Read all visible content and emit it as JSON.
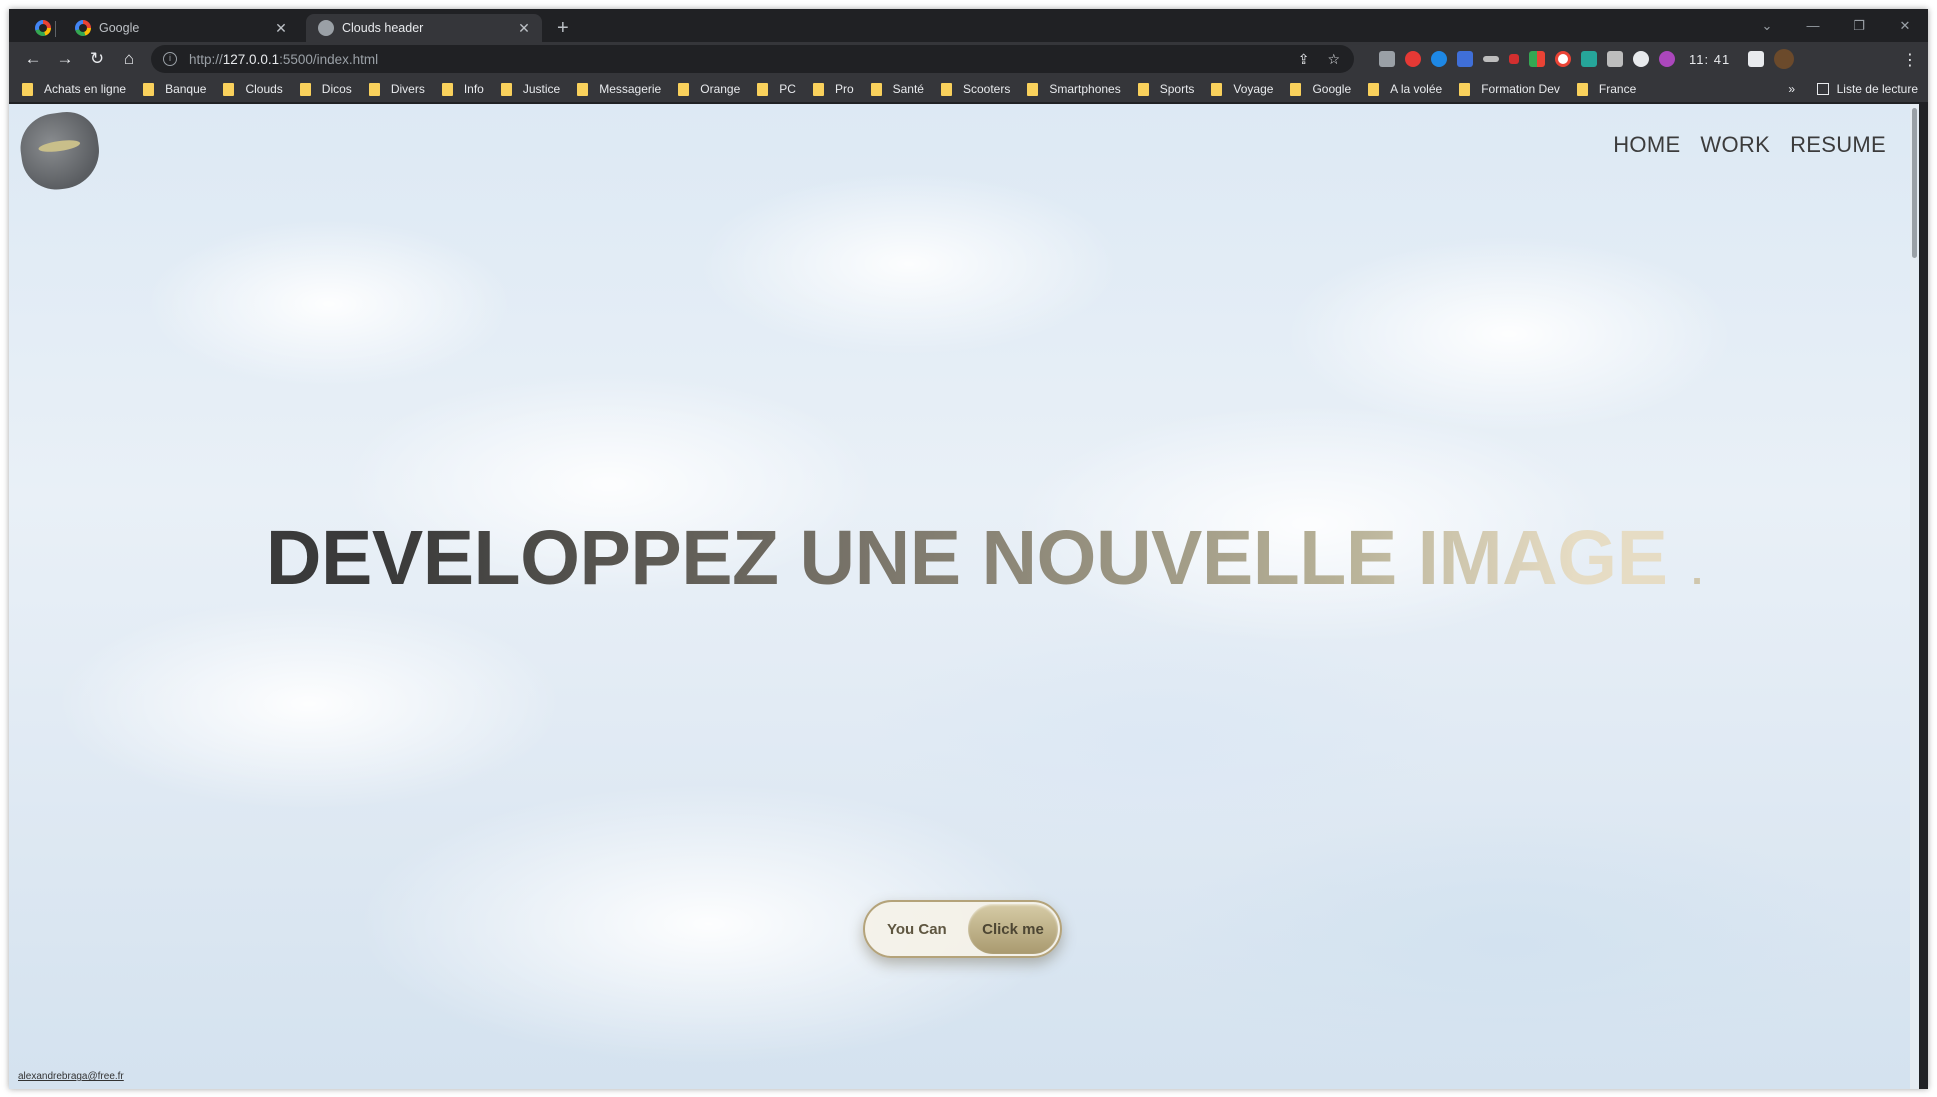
{
  "browser": {
    "tabs": [
      {
        "label": "Google"
      },
      {
        "label": "Clouds header"
      }
    ],
    "new_tab": "+",
    "window_controls": {
      "minimize": "—",
      "restore": "❐",
      "close": "✕"
    },
    "address": {
      "prefix": "http://",
      "host": "127.0.0.1",
      "path": ":5500/index.html"
    },
    "clock": "11: 41",
    "bookmarks": [
      "Achats en ligne",
      "Banque",
      "Clouds",
      "Dicos",
      "Divers",
      "Info",
      "Justice",
      "Messagerie",
      "Orange",
      "PC",
      "Pro",
      "Santé",
      "Scooters",
      "Smartphones",
      "Sports",
      "Voyage",
      "Google",
      "A la volée",
      "Formation Dev",
      "France"
    ],
    "bookmarks_more": "»",
    "reading_list": "Liste de lecture"
  },
  "page": {
    "nav": [
      "HOME",
      "WORK",
      "RESUME"
    ],
    "hero": {
      "title": "DEVELOPPEZ UNE NOUVELLE IMAGE",
      "dot": "."
    },
    "button": {
      "left_label": "You Can",
      "right_label": "Click me"
    },
    "footer_email": "alexandrebraga@free.fr"
  },
  "colors": {
    "browser_dark": "#202124",
    "toolbar": "#35363a",
    "bookmark_folder": "#f9d15c",
    "hero_start": "#3a3a3a",
    "hero_end": "#e6dcc4",
    "button_gold": "#b4a37a"
  }
}
